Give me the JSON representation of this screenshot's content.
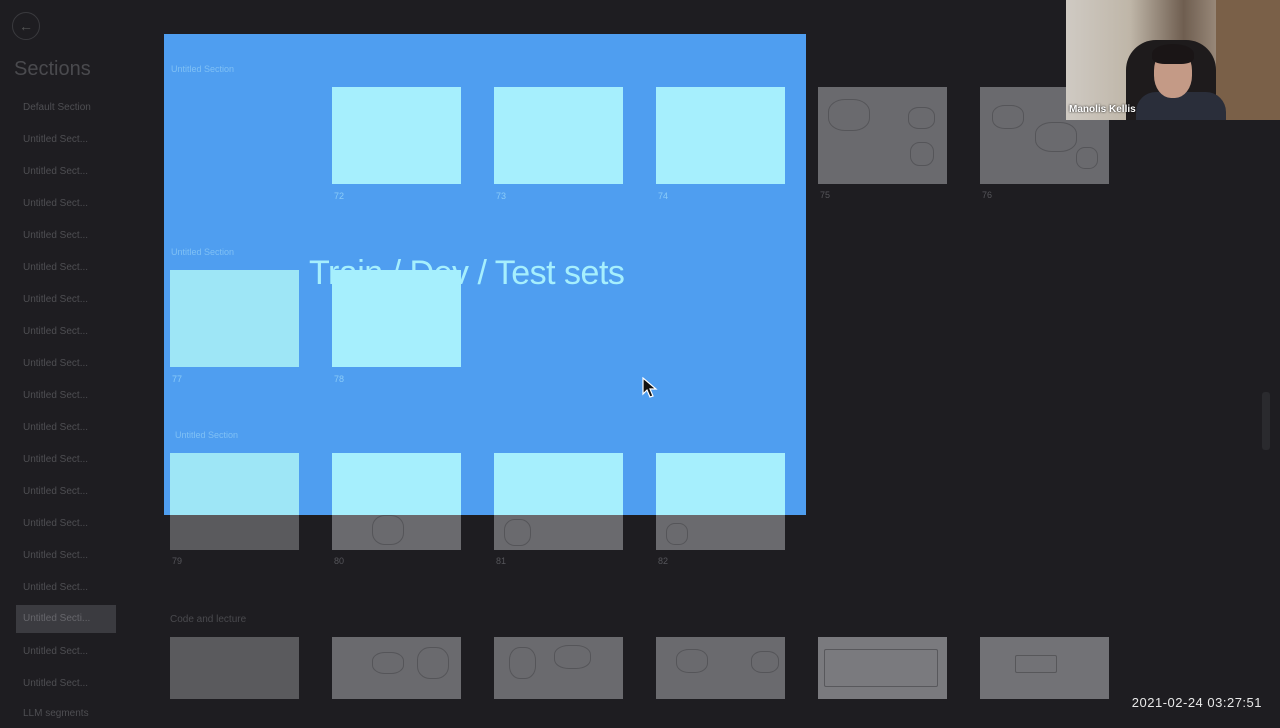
{
  "sidebar": {
    "back_icon": "back-arrow-icon",
    "title": "Sections",
    "items": [
      {
        "label": "Default Section"
      },
      {
        "label": "Untitled Sect..."
      },
      {
        "label": "Untitled Sect..."
      },
      {
        "label": "Untitled Sect..."
      },
      {
        "label": "Untitled Sect..."
      },
      {
        "label": "Untitled Sect..."
      },
      {
        "label": "Untitled Sect..."
      },
      {
        "label": "Untitled Sect..."
      },
      {
        "label": "Untitled Sect..."
      },
      {
        "label": "Untitled Sect..."
      },
      {
        "label": "Untitled Sect..."
      },
      {
        "label": "Untitled Sect..."
      },
      {
        "label": "Untitled Sect..."
      },
      {
        "label": "Untitled Sect..."
      },
      {
        "label": "Untitled Sect..."
      },
      {
        "label": "Untitled Sect..."
      },
      {
        "label": "Untitled Secti..."
      },
      {
        "label": "Untitled Sect..."
      },
      {
        "label": "Untitled Sect..."
      },
      {
        "label": "LLM segments"
      }
    ],
    "active_index": 16
  },
  "sections": {
    "row1_title": "Untitled Section",
    "row1_nums": [
      "72",
      "73",
      "74",
      "75",
      "76"
    ],
    "row2_title": "Untitled Section",
    "row2_nums": [
      "77",
      "78"
    ],
    "row3_title": "Untitled Section",
    "row3_nums": [
      "79",
      "80",
      "81",
      "82"
    ],
    "row4_title": "Code and lecture"
  },
  "overlay": {
    "slide_title": "Train / Dev / Test sets",
    "color": "#4f9ef0",
    "thumb_color": "#a6effd"
  },
  "webcam": {
    "name": "Manolis Kellis"
  },
  "timestamp": "2021-02-24  03:27:51"
}
